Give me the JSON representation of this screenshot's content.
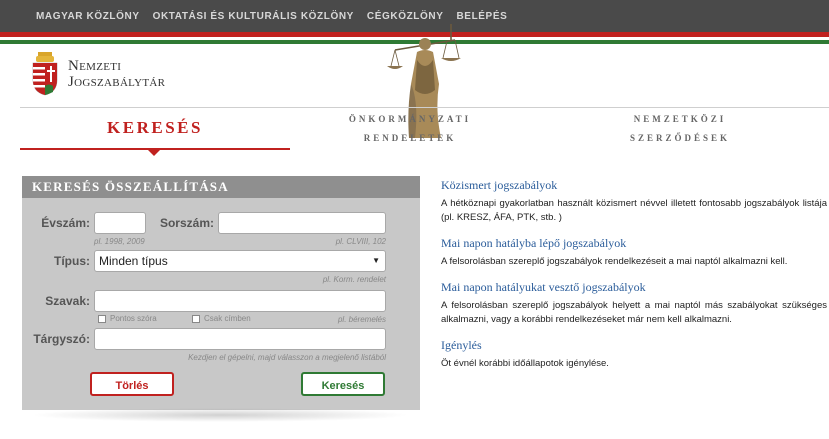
{
  "topnav": {
    "items": [
      "MAGYAR KÖZLÖNY",
      "OKTATÁSI ÉS KULTURÁLIS KÖZLÖNY",
      "CÉGKÖZLÖNY",
      "BELÉPÉS"
    ]
  },
  "header": {
    "title_line1": "Nemzeti",
    "title_line2": "Jogszabálytár"
  },
  "tabs": {
    "search": "KERESÉS",
    "local_line1": "ÖNKORMÁNYZATI",
    "local_line2": "RENDELETEK",
    "intl_line1": "NEMZETKÖZI",
    "intl_line2": "SZERZŐDÉSEK"
  },
  "form": {
    "title": "KERESÉS ÖSSZEÁLLÍTÁSA",
    "year_label": "Évszám:",
    "year_value": "",
    "year_hint": "pl. 1998, 2009",
    "number_label": "Sorszám:",
    "number_value": "",
    "number_hint": "pl. CLVIII, 102",
    "type_label": "Típus:",
    "type_value": "Minden típus",
    "type_hint": "pl. Korm. rendelet",
    "words_label": "Szavak:",
    "words_value": "",
    "exact_label": "Pontos szóra",
    "title_only_label": "Csak címben",
    "words_hint": "pl. béremelés",
    "subject_label": "Tárgyszó:",
    "subject_value": "",
    "subject_hint": "Kezdjen el gépelni, majd válasszon a megjelenő listából",
    "clear_button": "Törlés",
    "search_button": "Keresés"
  },
  "info": [
    {
      "title": "Közismert jogszabályok",
      "text": "A hétköznapi gyakorlatban használt közismert névvel illetett fontosabb jogszabályok listája (pl. KRESZ, ÁFA, PTK, stb. )"
    },
    {
      "title": "Mai napon hatályba lépő jogszabályok",
      "text": "A felsorolásban szereplő jogszabályok rendelkezéseit a mai naptól alkalmazni kell."
    },
    {
      "title": "Mai napon hatályukat vesztő jogszabályok",
      "text": "A felsorolásban szereplő jogszabályok helyett a mai naptól más szabályokat szükséges alkalmazni, vagy a korábbi rendelkezéseket már nem kell alkalmazni."
    },
    {
      "title": "Igénylés",
      "text": "Öt évnél korábbi időállapotok igénylése."
    }
  ],
  "colors": {
    "topbar": "#4a4a4a",
    "accent_red": "#c0211f",
    "accent_green": "#2f7a34",
    "link_blue": "#2a5c9a",
    "panel_bg": "#c8c8c8",
    "panel_head": "#8f8f8f"
  }
}
